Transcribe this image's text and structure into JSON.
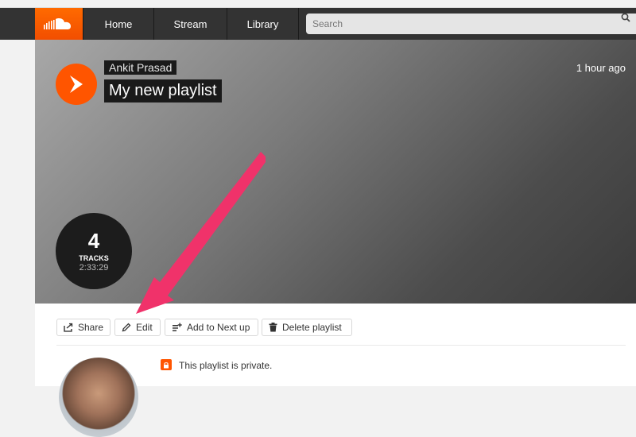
{
  "nav": {
    "home": "Home",
    "stream": "Stream",
    "library": "Library",
    "search_placeholder": "Search"
  },
  "hero": {
    "artist": "Ankit Prasad",
    "title": "My new playlist",
    "time_ago": "1 hour ago",
    "tracks_count": "4",
    "tracks_label": "TRACKS",
    "duration": "2:33:29"
  },
  "actions": {
    "share": "Share",
    "edit": "Edit",
    "add_next": "Add to Next up",
    "delete": "Delete playlist"
  },
  "privacy": {
    "text": "This playlist is private."
  },
  "colors": {
    "brand": "#ff5500",
    "annotation_arrow": "#f0326a"
  },
  "icons": [
    "soundcloud-logo-icon",
    "search-icon",
    "play-icon",
    "share-icon",
    "pencil-icon",
    "add-to-queue-icon",
    "trash-icon",
    "lock-icon"
  ]
}
